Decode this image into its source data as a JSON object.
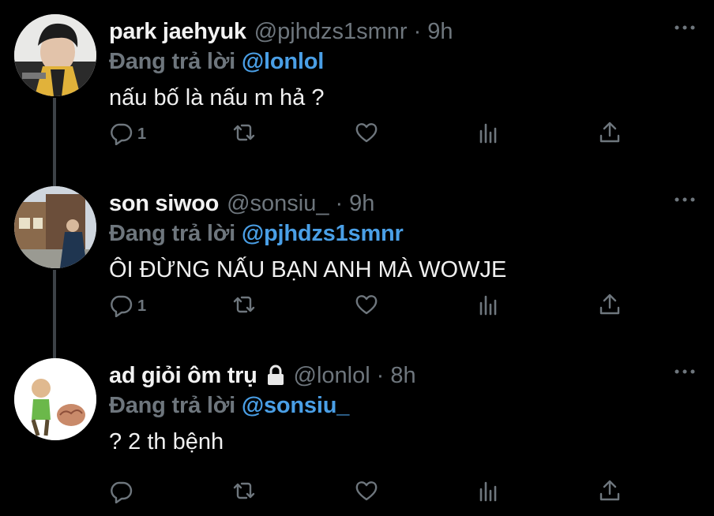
{
  "replying_label": "Đang trả lời",
  "tweets": [
    {
      "name": "park jaehyuk",
      "handle": "@pjhdzs1smnr",
      "time": "9h",
      "reply_to": "@lonlol",
      "text": "nấu bố là nấu m hả ?",
      "reply_count": "1",
      "locked": false
    },
    {
      "name": "son siwoo",
      "handle": "@sonsiu_",
      "time": "9h",
      "reply_to": "@pjhdzs1smnr",
      "text": "ÔI ĐỪNG NẤU BẠN ANH MÀ WOWJE",
      "reply_count": "1",
      "locked": false
    },
    {
      "name": "ad giỏi ôm trụ",
      "handle": "@lonlol",
      "time": "8h",
      "reply_to": "@sonsiu_",
      "text": "? 2 th bệnh",
      "reply_count": "",
      "locked": true
    }
  ],
  "separator": "·",
  "icons": [
    "reply-icon",
    "retweet-icon",
    "like-icon",
    "analytics-icon",
    "share-icon",
    "more-icon",
    "lock-icon"
  ],
  "colors": {
    "background": "#000000",
    "mention": "#4a9fe6",
    "muted": "#6e767d",
    "text": "#f0f0f0",
    "thread_line": "#3d4247"
  }
}
